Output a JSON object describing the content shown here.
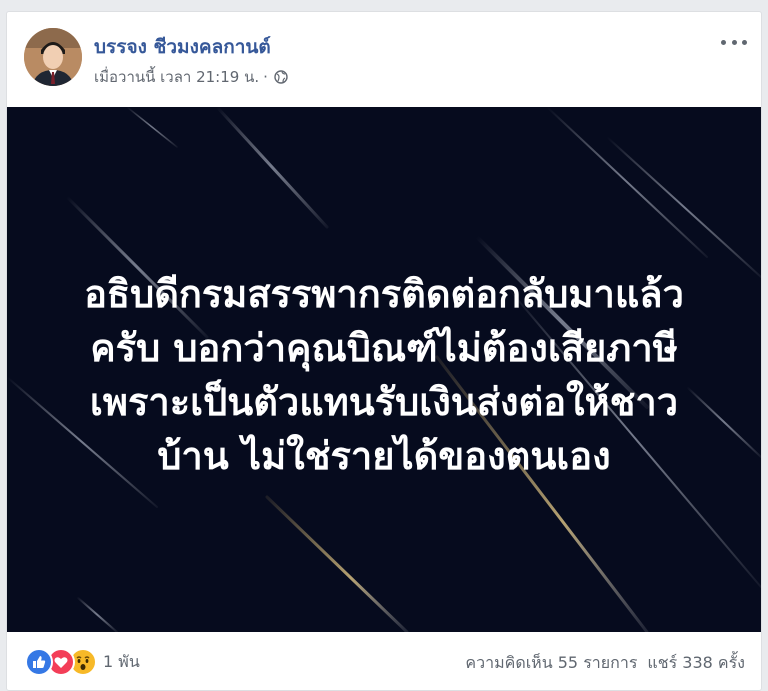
{
  "post": {
    "author": "บรรจง ชีวมงคลกานต์",
    "timestamp": "เมื่อวานนี้ เวลา 21:19 น.",
    "separator": "·",
    "privacy_icon": "globe-icon",
    "menu_icon": "more-options-icon",
    "image_text_lines": [
      "อธิบดีกรมสรรพากรติดต่อกลับมาแล้ว",
      "ครับ บอกว่าคุณบิณฑ์ไม่ต้องเสียภาษี",
      "เพราะเป็นตัวแทนรับเงินส่งต่อให้ชาว",
      "บ้าน ไม่ใช่รายได้ของตนเอง"
    ]
  },
  "footer": {
    "reaction_icons": [
      "like-icon",
      "love-icon",
      "wow-icon"
    ],
    "reaction_count": "1 พัน",
    "comments": "ความคิดเห็น 55 รายการ",
    "shares": "แชร์ 338 ครั้ง"
  },
  "colors": {
    "author": "#365899",
    "image_background": "#060b1e",
    "like": "#3578e5",
    "love": "#f33e58",
    "wow": "#f7b928"
  }
}
